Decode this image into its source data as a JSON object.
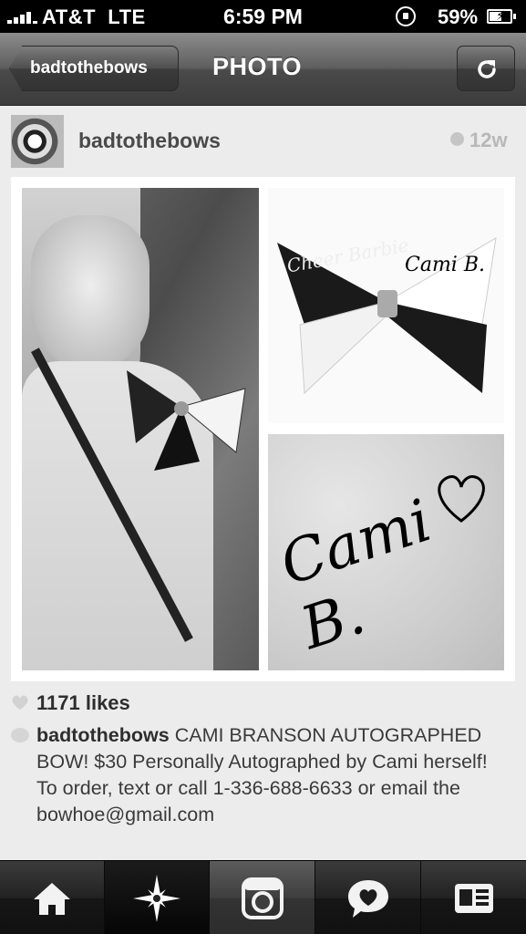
{
  "status_bar": {
    "carrier": "AT&T",
    "network": "LTE",
    "time": "6:59 PM",
    "battery": "59%",
    "battery_level": 0.59
  },
  "nav": {
    "back_label": "badtothebows",
    "title": "PHOTO"
  },
  "post": {
    "username": "badtothebows",
    "age": "12w",
    "photo_texts": {
      "bow_top_left": "Cheer Barbie",
      "bow_signature": "Cami B.",
      "closeup_signature": "Cami B."
    },
    "likes": "1171 likes",
    "caption_user": "badtothebows",
    "caption_text": "CAMI BRANSON AUTOGRAPHED BOW! $30  Personally Autographed by Cami herself!  To order, text or call 1-336-688-6633 or email the bowhoe@gmail.com"
  },
  "tabs": [
    {
      "icon": "home-icon"
    },
    {
      "icon": "explore-star-icon"
    },
    {
      "icon": "camera-icon"
    },
    {
      "icon": "activity-heart-bubble-icon"
    },
    {
      "icon": "profile-card-icon"
    }
  ]
}
